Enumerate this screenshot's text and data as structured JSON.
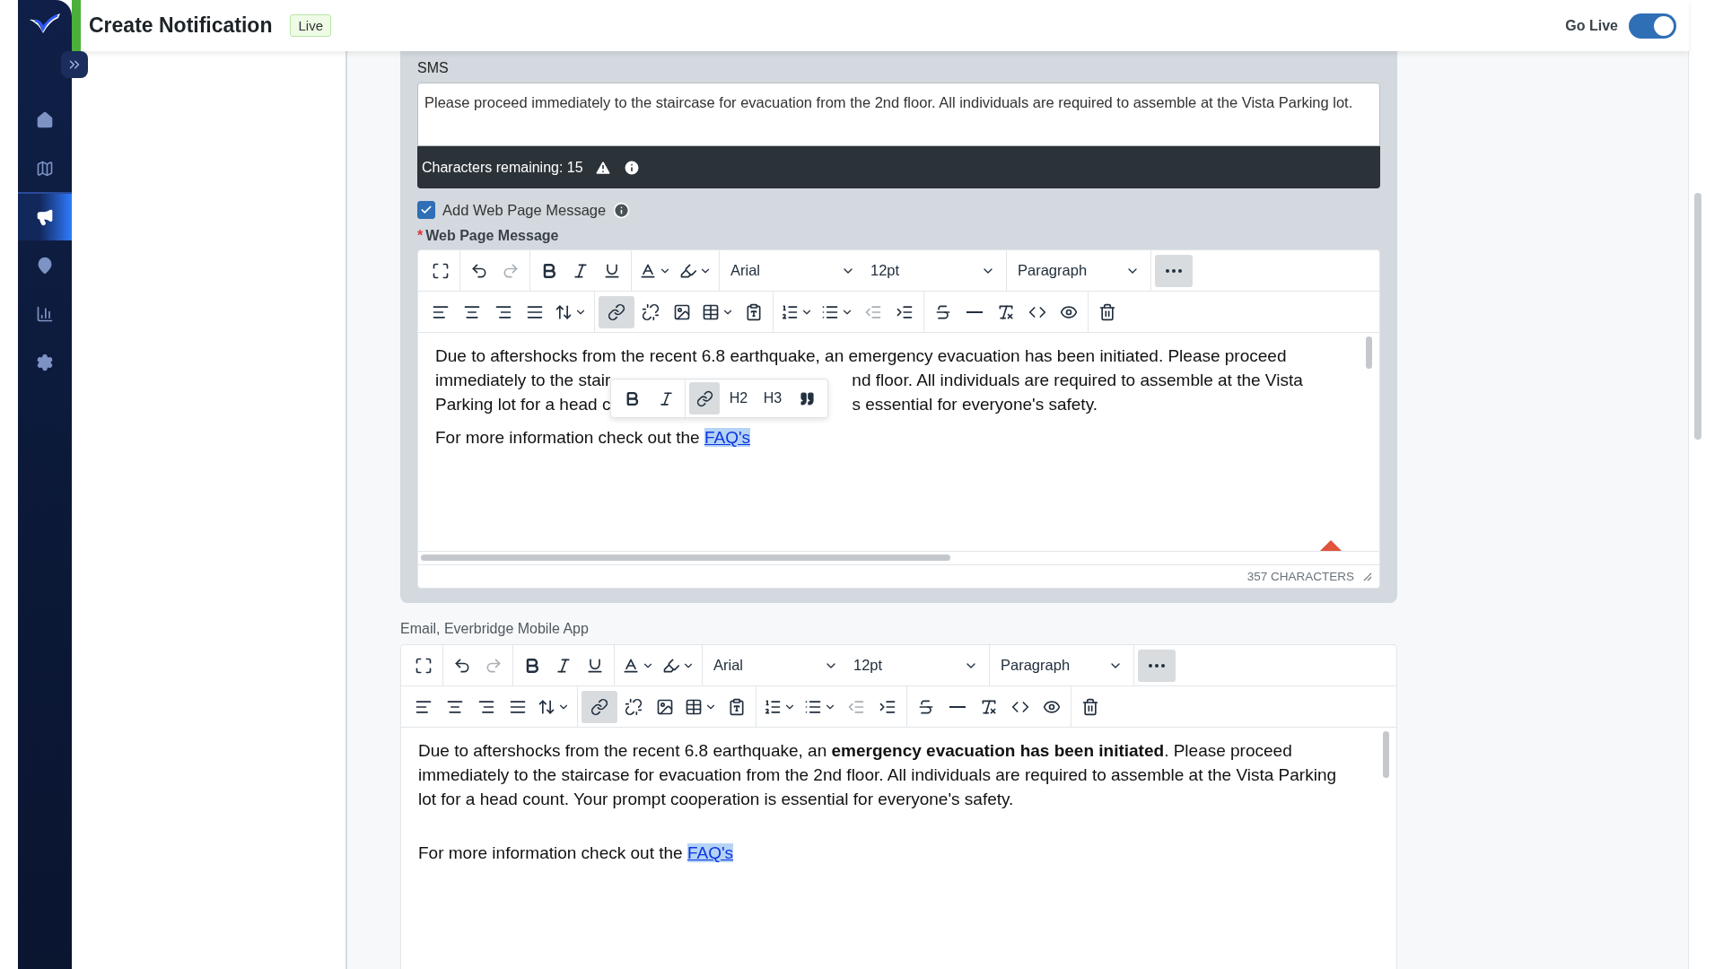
{
  "header": {
    "title": "Create Notification",
    "badge": "Live",
    "go_live": {
      "label": "Go Live",
      "on": true
    }
  },
  "sidebar": {
    "items": [
      {
        "kind": "home",
        "selected": false
      },
      {
        "kind": "map",
        "selected": false
      },
      {
        "kind": "megaphone",
        "selected": true
      },
      {
        "kind": "pin",
        "selected": false
      },
      {
        "kind": "chart",
        "selected": false
      },
      {
        "kind": "settings",
        "selected": false
      }
    ]
  },
  "sms": {
    "label": "SMS",
    "value": "Please proceed immediately to the staircase for evacuation from the 2nd floor. All individuals are required to assemble at the Vista Parking lot.",
    "remaining": "Characters remaining: 15"
  },
  "web_page": {
    "checkbox": {
      "label": "Add Web Page Message",
      "checked": true
    },
    "label": "Web Page Message",
    "required_mark": "*",
    "editor": {
      "toolbar": {
        "font": "Arial",
        "size": "12pt",
        "block": "Paragraph",
        "link_active": true,
        "more_open": true,
        "redo_disabled": true,
        "outdent_disabled": true
      },
      "lines": [
        [
          "Due to aftershocks from the recent 6.8 earthquake, an emergency evacuation has been initiated. Please proceed"
        ],
        [
          "immediately to the stair",
          "nd floor. All individuals are required to assemble at the Vista"
        ],
        [
          "Parking lot for a head c",
          "s essential for everyone's safety."
        ]
      ],
      "popup": {
        "h2": "H2",
        "h3": "H3",
        "link_active": true
      },
      "link_line": {
        "text": "For more information check out the ",
        "link": "FAQ's"
      },
      "count": "357 CHARACTERS"
    }
  },
  "email": {
    "label": "Email, Everbridge Mobile App",
    "editor": {
      "toolbar": {
        "font": "Arial",
        "size": "12pt",
        "block": "Paragraph",
        "link_active": true,
        "more_open": true,
        "redo_disabled": true,
        "outdent_disabled": true
      },
      "paragraph": "Due to aftershocks from the recent 6.8 earthquake, an **emergency evacuation has been initiated**. Please proceed immediately to the staircase for evacuation from the 2nd floor. All individuals are required to assemble at the Vista Parking lot for a head count. Your prompt cooperation is essential for everyone's safety.",
      "link_line": {
        "text": "For more information check out the ",
        "link": "FAQ's"
      }
    }
  }
}
